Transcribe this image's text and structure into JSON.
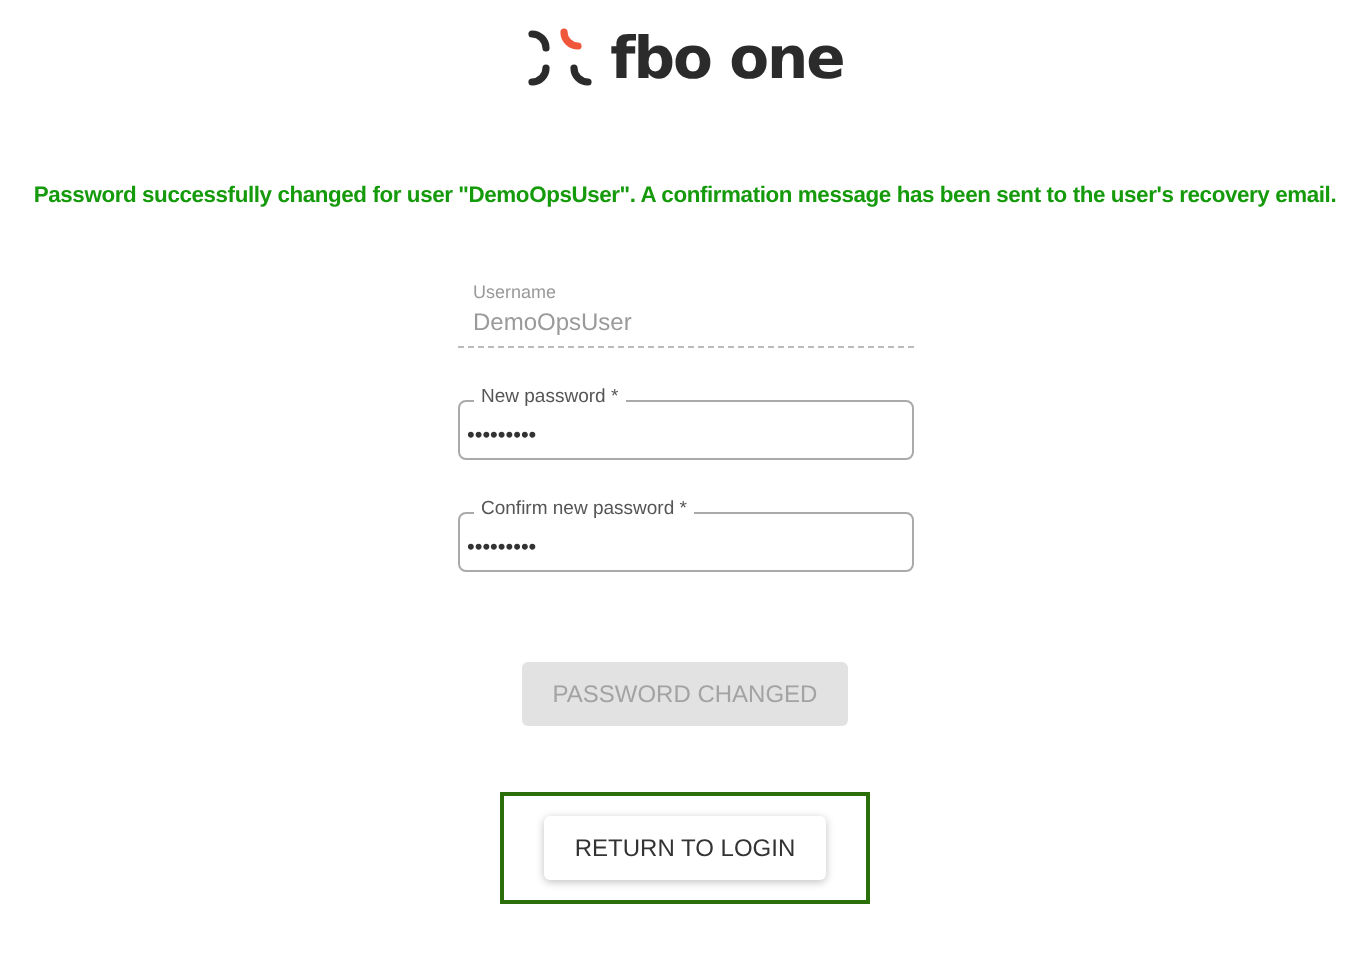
{
  "logo": {
    "text": "fbo one"
  },
  "message": "Password successfully changed for user \"DemoOpsUser\". A confirmation message has been sent to the user's recovery email.",
  "fields": [
    {
      "kind": "readonly",
      "label": "Username",
      "value": "DemoOpsUser"
    },
    {
      "kind": "outlined",
      "label": "New password *",
      "value": "•••••••••"
    },
    {
      "kind": "outlined",
      "label": "Confirm new password *",
      "value": "•••••••••"
    }
  ],
  "buttons": [
    {
      "label": "PASSWORD CHANGED",
      "disabled": true,
      "highlighted": false
    },
    {
      "label": "RETURN TO LOGIN",
      "disabled": false,
      "highlighted": true
    }
  ]
}
